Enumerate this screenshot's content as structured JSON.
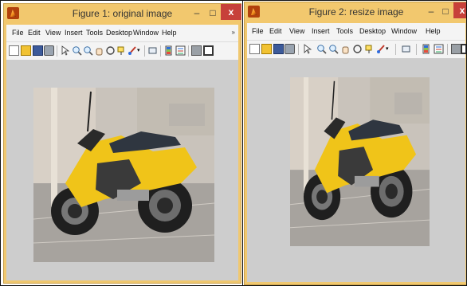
{
  "figure1": {
    "title": "Figure 1: original image",
    "minimize": "–",
    "maximize": "□",
    "close": "x",
    "menu": [
      "File",
      "Edit",
      "View",
      "Insert",
      "Tools",
      "Desktop",
      "Window",
      "Help"
    ],
    "menu_overflow": "»",
    "image_alt": "motorcycle photo"
  },
  "figure2": {
    "title": "Figure 2: resize image",
    "minimize": "–",
    "maximize": "□",
    "close": "x",
    "menu": [
      "File",
      "Edit",
      "View",
      "Insert",
      "Tools",
      "Desktop",
      "Window",
      "Help"
    ],
    "image_alt": "motorcycle photo resized"
  },
  "colors": {
    "titlebar": "#f2c86e",
    "close": "#c7403a",
    "canvas": "#cdcdcd",
    "bike_yellow": "#f0c419"
  },
  "toolbar_icons": [
    "new-file-icon",
    "open-folder-icon",
    "save-icon",
    "print-icon",
    "pointer-icon",
    "zoom-in-icon",
    "zoom-out-icon",
    "pan-hand-icon",
    "rotate-3d-icon",
    "data-cursor-icon",
    "brush-icon",
    "link-icon",
    "colorbar-icon",
    "legend-icon",
    "hide-plot-tools-icon",
    "show-plot-tools-icon"
  ]
}
